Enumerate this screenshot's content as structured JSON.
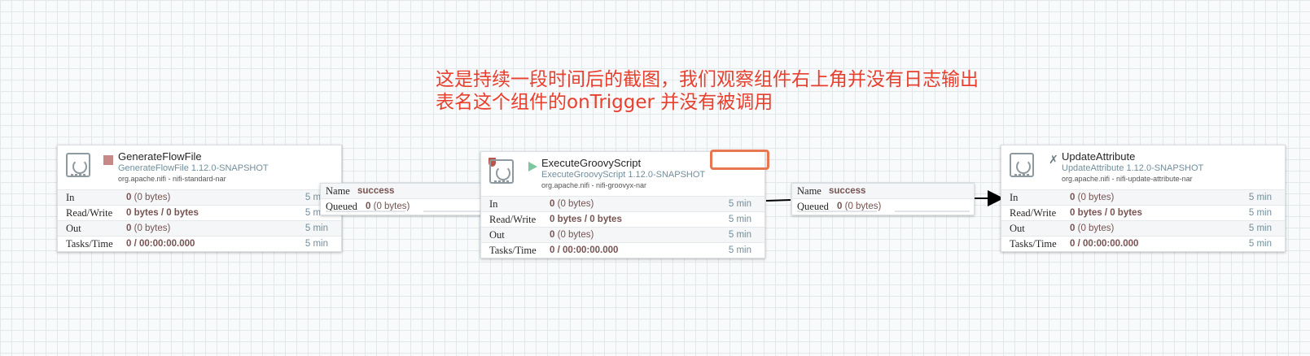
{
  "annotation": {
    "line1": "这是持续一段时间后的截图，我们观察组件右上角并没有日志输出",
    "line2": "表名这个组件的onTrigger 并没有被调用",
    "color": "#e8402e"
  },
  "processors": {
    "generate": {
      "name": "GenerateFlowFile",
      "type": "GenerateFlowFile 1.12.0-SNAPSHOT",
      "bundle": "org.apache.nifi - nifi-standard-nar",
      "status": "stopped",
      "status_icon": "stop-icon",
      "stats": {
        "in": {
          "label": "In",
          "count": "0",
          "size": "(0 bytes)",
          "time": "5 min"
        },
        "readwrite": {
          "label": "Read/Write",
          "value": "0 bytes / 0 bytes",
          "time": "5 min"
        },
        "out": {
          "label": "Out",
          "count": "0",
          "size": "(0 bytes)",
          "time": "5 min"
        },
        "tasks": {
          "label": "Tasks/Time",
          "value": "0 / 00:00:00.000",
          "time": "5 min"
        }
      }
    },
    "groovy": {
      "name": "ExecuteGroovyScript",
      "type": "ExecuteGroovyScript 1.12.0-SNAPSHOT",
      "bundle": "org.apache.nifi - nifi-groovyx-nar",
      "status": "running",
      "status_icon": "play-icon",
      "stats": {
        "in": {
          "label": "In",
          "count": "0",
          "size": "(0 bytes)",
          "time": "5 min"
        },
        "readwrite": {
          "label": "Read/Write",
          "value": "0 bytes / 0 bytes",
          "time": "5 min"
        },
        "out": {
          "label": "Out",
          "count": "0",
          "size": "(0 bytes)",
          "time": "5 min"
        },
        "tasks": {
          "label": "Tasks/Time",
          "value": "0 / 00:00:00.000",
          "time": "5 min"
        }
      }
    },
    "update": {
      "name": "UpdateAttribute",
      "type": "UpdateAttribute 1.12.0-SNAPSHOT",
      "bundle": "org.apache.nifi - nifi-update-attribute-nar",
      "status": "invalid",
      "status_icon": "disabled-icon",
      "stats": {
        "in": {
          "label": "In",
          "count": "0",
          "size": "(0 bytes)",
          "time": "5 min"
        },
        "readwrite": {
          "label": "Read/Write",
          "value": "0 bytes / 0 bytes",
          "time": "5 min"
        },
        "out": {
          "label": "Out",
          "count": "0",
          "size": "(0 bytes)",
          "time": "5 min"
        },
        "tasks": {
          "label": "Tasks/Time",
          "value": "0 / 00:00:00.000",
          "time": "5 min"
        }
      }
    }
  },
  "connections": {
    "c1": {
      "name_label": "Name",
      "name": "success",
      "queued_label": "Queued",
      "count": "0",
      "size": "(0 bytes)"
    },
    "c2": {
      "name_label": "Name",
      "name": "success",
      "queued_label": "Queued",
      "count": "0",
      "size": "(0 bytes)"
    }
  },
  "colors": {
    "canvas_bg": "#f9fafb",
    "grid": "#e3e8eb",
    "value_text": "#775351",
    "meta_text": "#728e9b",
    "highlight": "#e87650"
  }
}
